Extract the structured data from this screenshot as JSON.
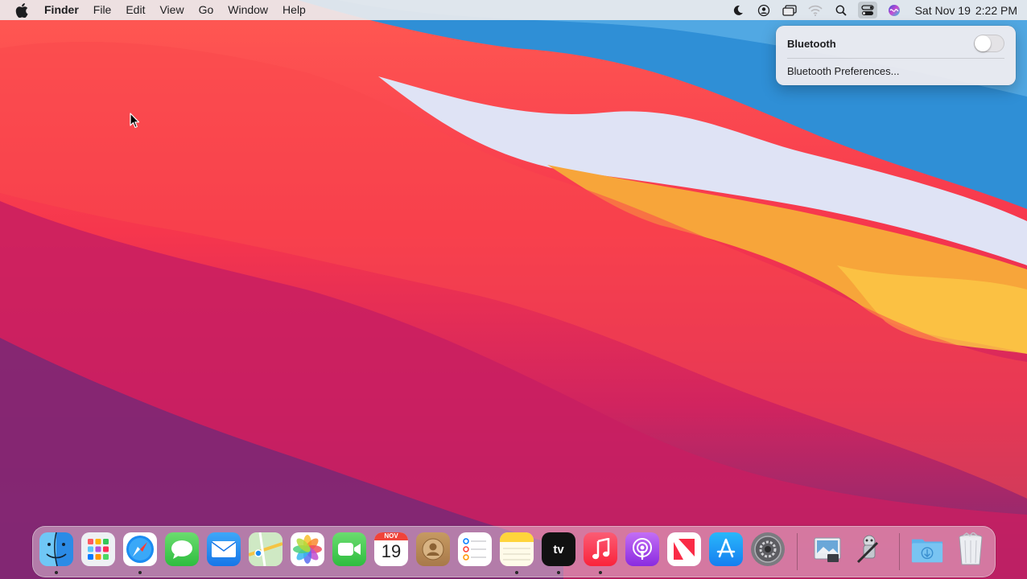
{
  "menubar": {
    "app_name": "Finder",
    "menus": [
      "File",
      "Edit",
      "View",
      "Go",
      "Window",
      "Help"
    ],
    "status_icons": [
      "do-not-disturb-moon-icon",
      "user-account-icon",
      "screen-mirroring-icon",
      "wifi-icon",
      "spotlight-search-icon",
      "control-center-icon",
      "siri-icon"
    ],
    "clock": {
      "date": "Sat Nov 19",
      "time": "2:22 PM"
    }
  },
  "bluetooth_menu": {
    "title": "Bluetooth",
    "toggle_on": false,
    "preferences_label": "Bluetooth Preferences..."
  },
  "dock": {
    "apps": [
      {
        "name": "Finder",
        "icon": "finder-icon",
        "running": true
      },
      {
        "name": "Launchpad",
        "icon": "launchpad-icon",
        "running": false
      },
      {
        "name": "Safari",
        "icon": "safari-icon",
        "running": true
      },
      {
        "name": "Messages",
        "icon": "messages-icon",
        "running": false
      },
      {
        "name": "Mail",
        "icon": "mail-icon",
        "running": false
      },
      {
        "name": "Maps",
        "icon": "maps-icon",
        "running": false
      },
      {
        "name": "Photos",
        "icon": "photos-icon",
        "running": false
      },
      {
        "name": "FaceTime",
        "icon": "facetime-icon",
        "running": false
      },
      {
        "name": "Calendar",
        "icon": "calendar-icon",
        "running": false
      },
      {
        "name": "Contacts",
        "icon": "contacts-icon",
        "running": false
      },
      {
        "name": "Reminders",
        "icon": "reminders-icon",
        "running": false
      },
      {
        "name": "Notes",
        "icon": "notes-icon",
        "running": true
      },
      {
        "name": "TV",
        "icon": "apple-tv-icon",
        "running": true
      },
      {
        "name": "Music",
        "icon": "music-icon",
        "running": true
      },
      {
        "name": "Podcasts",
        "icon": "podcasts-icon",
        "running": false
      },
      {
        "name": "News",
        "icon": "news-icon",
        "running": false
      },
      {
        "name": "App Store",
        "icon": "app-store-icon",
        "running": false
      },
      {
        "name": "System Preferences",
        "icon": "system-preferences-icon",
        "running": false
      }
    ],
    "extras": [
      {
        "name": "Preview",
        "icon": "preview-icon"
      },
      {
        "name": "Automator",
        "icon": "automator-icon"
      },
      {
        "name": "Downloads",
        "icon": "downloads-folder-icon"
      },
      {
        "name": "Trash",
        "icon": "trash-icon"
      }
    ],
    "calendar_month": "NOV",
    "calendar_day": "19",
    "tv_label": "tv"
  },
  "colors": {
    "menubar_bg": "#ececee",
    "wallpaper_red": "#f6364d",
    "wallpaper_blue": "#2f8fd6",
    "wallpaper_orange": "#f7a53a"
  }
}
